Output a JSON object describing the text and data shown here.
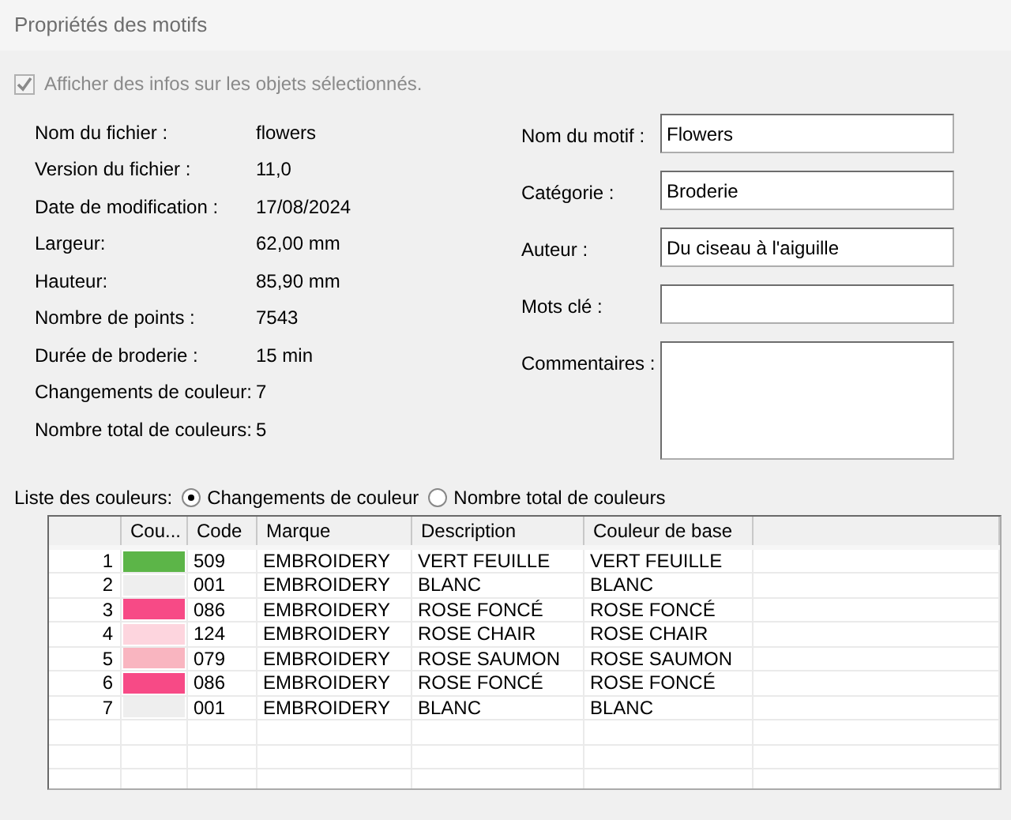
{
  "panel": {
    "title": "Propriétés des motifs"
  },
  "show_info": {
    "label": "Afficher des infos sur les objets sélectionnés.",
    "checked": true,
    "disabled": true
  },
  "info": [
    {
      "label": "Nom du fichier :",
      "value": "flowers"
    },
    {
      "label": "Version du fichier :",
      "value": "11,0"
    },
    {
      "label": "Date de modification :",
      "value": "17/08/2024"
    },
    {
      "label": "Largeur:",
      "value": "62,00 mm"
    },
    {
      "label": "Hauteur:",
      "value": "85,90 mm"
    },
    {
      "label": "Nombre de points :",
      "value": "7543"
    },
    {
      "label": "Durée de broderie :",
      "value": "15 min"
    },
    {
      "label": "Changements de couleur:",
      "value": "7"
    },
    {
      "label": "Nombre total de couleurs:",
      "value": "5"
    }
  ],
  "fields": [
    {
      "label": "Nom du motif :",
      "value": "Flowers",
      "kind": "line"
    },
    {
      "label": "Catégorie :",
      "value": "Broderie",
      "kind": "line"
    },
    {
      "label": "Auteur :",
      "value": "Du ciseau à l'aiguille",
      "kind": "line"
    },
    {
      "label": "Mots clé :",
      "kind": "line"
    },
    {
      "label": "Commentaires :",
      "kind": "multi"
    }
  ],
  "color_list": {
    "label": "Liste des couleurs:",
    "options": [
      {
        "label": "Changements de couleur",
        "selected": true
      },
      {
        "label": "Nombre total de couleurs",
        "selected": false
      }
    ]
  },
  "table": {
    "columns": [
      "Cou...",
      "Code",
      "Marque",
      "Description",
      "Couleur de base"
    ],
    "rows": [
      {
        "index": "1",
        "color": "#5cb548",
        "code": "509",
        "brand": "EMBROIDERY",
        "description": "VERT FEUILLE",
        "base": "VERT FEUILLE"
      },
      {
        "index": "2",
        "color": "#eeeeee",
        "code": "001",
        "brand": "EMBROIDERY",
        "description": "BLANC",
        "base": "BLANC"
      },
      {
        "index": "3",
        "color": "#f74a86",
        "code": "086",
        "brand": "EMBROIDERY",
        "description": "ROSE FONCÉ",
        "base": "ROSE FONCÉ"
      },
      {
        "index": "4",
        "color": "#fdd5de",
        "code": "124",
        "brand": "EMBROIDERY",
        "description": "ROSE CHAIR",
        "base": "ROSE CHAIR"
      },
      {
        "index": "5",
        "color": "#f9b5c0",
        "code": "079",
        "brand": "EMBROIDERY",
        "description": "ROSE SAUMON",
        "base": "ROSE SAUMON"
      },
      {
        "index": "6",
        "color": "#f74a86",
        "code": "086",
        "brand": "EMBROIDERY",
        "description": "ROSE FONCÉ",
        "base": "ROSE FONCÉ"
      },
      {
        "index": "7",
        "color": "#eeeeee",
        "code": "001",
        "brand": "EMBROIDERY",
        "description": "BLANC",
        "base": "BLANC"
      }
    ]
  }
}
